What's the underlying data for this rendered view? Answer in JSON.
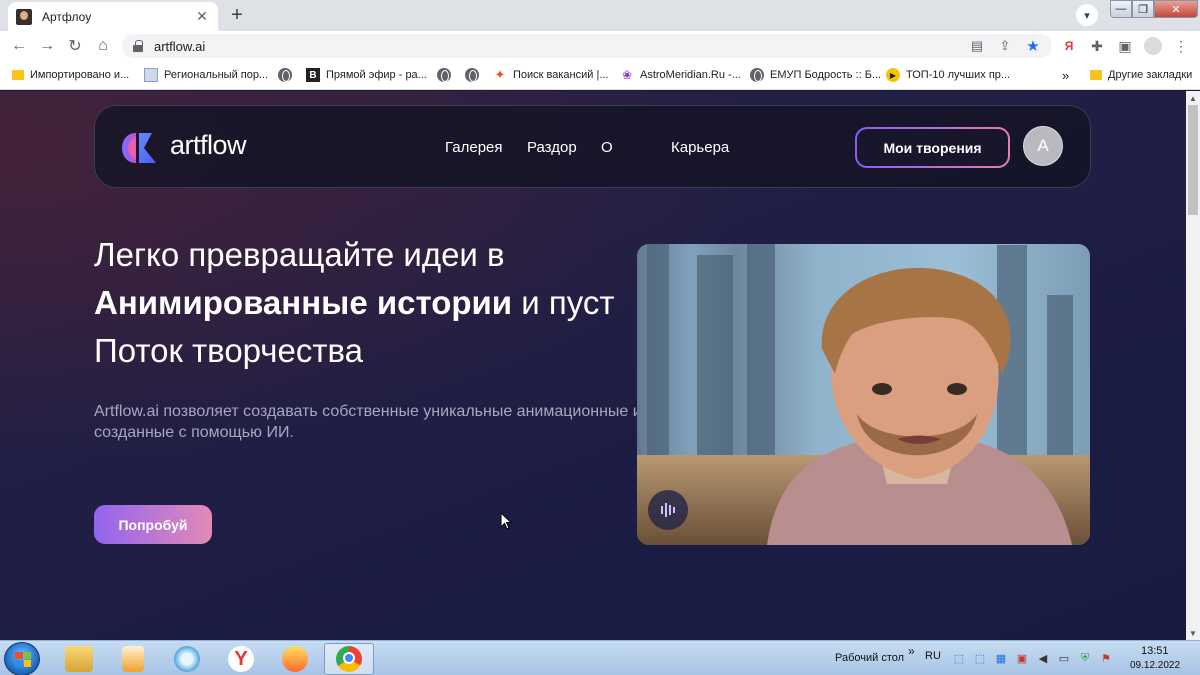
{
  "browser": {
    "tab_title": "Артфлоу",
    "tab_close": "✕",
    "new_tab": "+",
    "url": "artflow.ai",
    "bookmarks": [
      "Импортировано и...",
      "Региональный пор...",
      "Прямой эфир - ра...",
      "Поиск вакансий |...",
      "AstroMeridian.Ru -...",
      "ЕМУП Бодрость :: Б...",
      "ТОП-10 лучших пр..."
    ],
    "bookmarks_overflow": "»",
    "other_bookmarks": "Другие закладки"
  },
  "site": {
    "logo_text": "artflow",
    "nav": [
      "Галерея",
      "Раздор",
      "О",
      "Карьера"
    ],
    "creations_button": "Мои творения",
    "avatar_letter": "A",
    "hero": {
      "line1": "Легко превращайте идеи в",
      "line2_bold": "Анимированные истории",
      "line2_rest": " и пуст",
      "line3": "Поток творчества"
    },
    "description": [
      "Artflow.ai позволяет создавать собственные уникальные анимационные ис",
      "созданные с помощью ИИ."
    ],
    "try_button": "Попробуй"
  },
  "taskbar": {
    "desktop_label": "Рабочий стол",
    "chevron": "»",
    "language": "RU",
    "time": "13:51",
    "date": "09.12.2022"
  },
  "colors": {
    "accent_purple": "#9364f1",
    "accent_pink": "#e28ab4",
    "page_bg": "#1b1c44"
  }
}
